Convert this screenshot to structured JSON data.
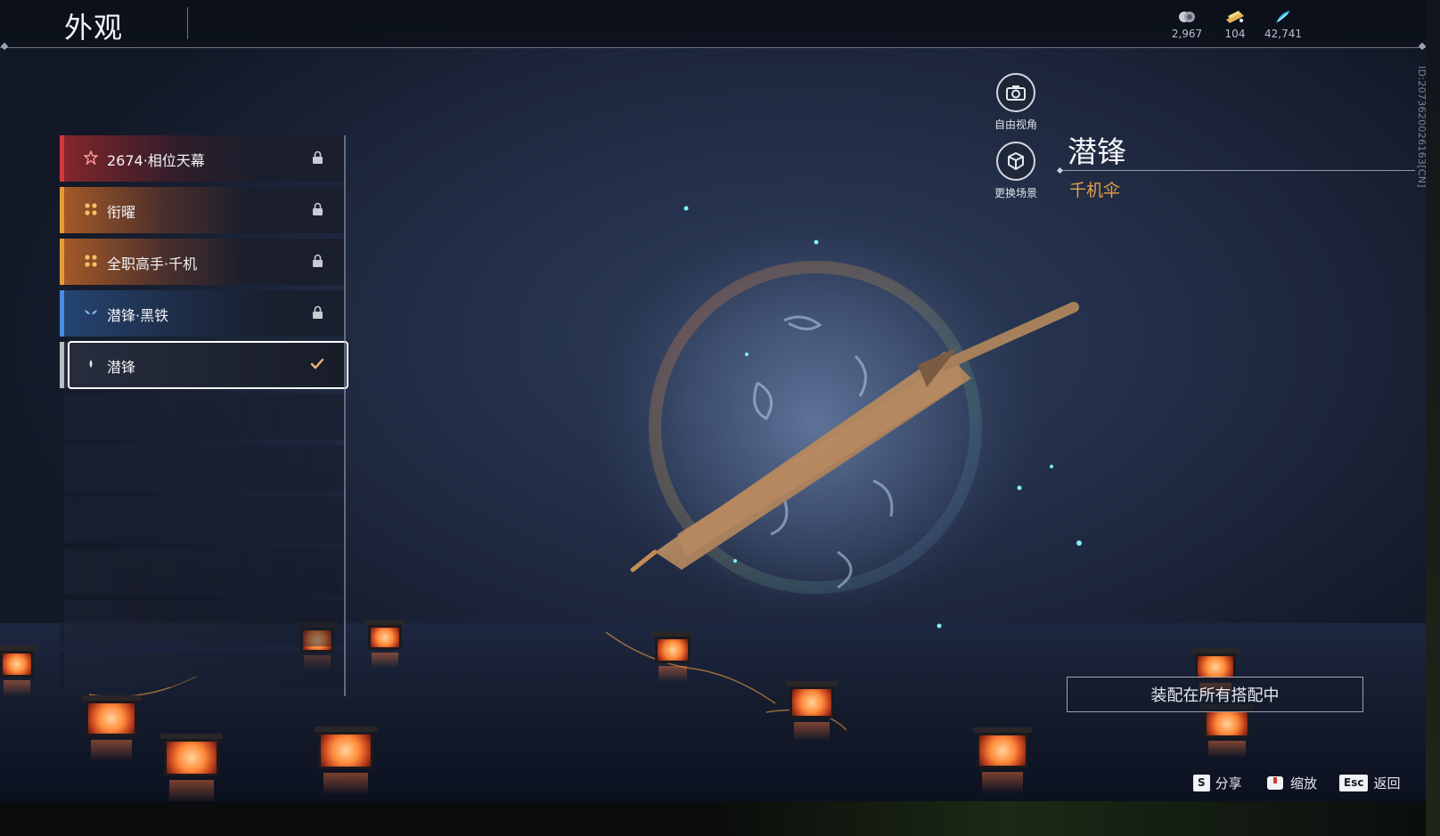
{
  "header": {
    "title": "外观"
  },
  "currencies": [
    {
      "icon": "silver-coin-icon",
      "value": "2,967"
    },
    {
      "icon": "gold-ticket-icon",
      "value": "104"
    },
    {
      "icon": "blue-feather-icon",
      "value": "42,741"
    }
  ],
  "player_id": "ID:2073620026163[CN]",
  "skins": [
    {
      "label": "2674·相位天幕",
      "rarity": "red",
      "icon": "star-icon",
      "status": "locked"
    },
    {
      "label": "衔曜",
      "rarity": "gold",
      "icon": "flower-icon",
      "status": "locked"
    },
    {
      "label": "全职高手·千机",
      "rarity": "gold",
      "icon": "flower-icon",
      "status": "locked"
    },
    {
      "label": "潜锋·黑铁",
      "rarity": "blue",
      "icon": "wing-icon",
      "status": "locked"
    },
    {
      "label": "潜锋",
      "rarity": "white",
      "icon": "drop-icon",
      "status": "equipped"
    }
  ],
  "camera_buttons": [
    {
      "label": "自由视角",
      "icon": "camera-icon"
    },
    {
      "label": "更换场景",
      "icon": "scene-cube-icon"
    }
  ],
  "item": {
    "name": "潜锋",
    "type": "千机伞"
  },
  "equip_button": {
    "label": "装配在所有搭配中"
  },
  "key_hints": [
    {
      "key": "S",
      "label": "分享"
    },
    {
      "key": "",
      "label": "缩放",
      "icon": "mouse-icon"
    },
    {
      "key": "Esc",
      "label": "返回"
    }
  ],
  "colors": {
    "rarity_red": "#d33a3a",
    "rarity_gold": "#e79a3a",
    "rarity_blue": "#4a8ee4",
    "accent_type": "#e4a04a"
  }
}
